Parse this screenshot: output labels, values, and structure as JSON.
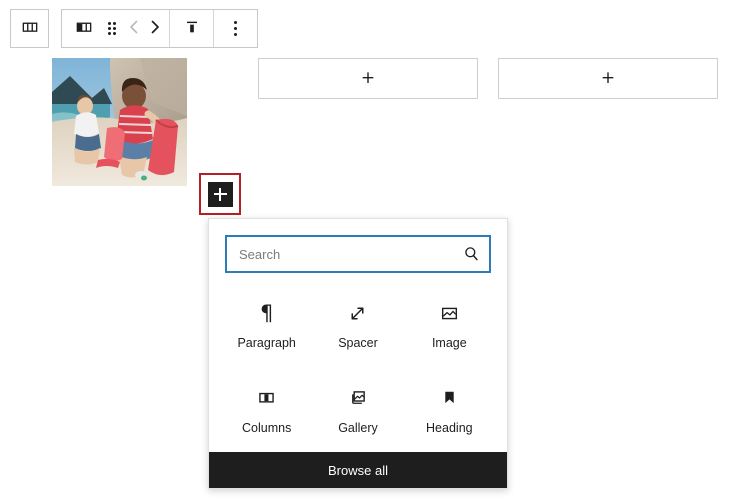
{
  "toolbar": {
    "block_type_button": {
      "icon": "columns-icon",
      "label": "Columns"
    },
    "items": [
      {
        "icon": "column-layout-icon",
        "label": "Change column layout"
      },
      {
        "icon": "drag-handle-icon",
        "label": "Drag"
      },
      {
        "icon": "chevron-left-icon",
        "label": "Move left"
      },
      {
        "icon": "chevron-right-icon",
        "label": "Move right"
      },
      {
        "icon": "align-top-icon",
        "label": "Change vertical alignment"
      },
      {
        "icon": "more-options-icon",
        "label": "Options"
      }
    ]
  },
  "content": {
    "image_block": {
      "icon": "beach-cleanup-photo",
      "alt": "Two people collecting litter in red bags on a sandy beach"
    },
    "placeholders": [
      {
        "icon": "plus-icon",
        "label": "+"
      },
      {
        "icon": "plus-icon",
        "label": "+"
      }
    ]
  },
  "inserter": {
    "button": {
      "icon": "plus-icon",
      "label": "Add block",
      "highlight_color": "#b32126"
    },
    "popover": {
      "search": {
        "placeholder": "Search",
        "value": "",
        "icon": "search-icon",
        "focus_color": "#2b7cb9"
      },
      "blocks": [
        {
          "label": "Paragraph",
          "icon": "paragraph-icon"
        },
        {
          "label": "Spacer",
          "icon": "spacer-icon"
        },
        {
          "label": "Image",
          "icon": "image-icon"
        },
        {
          "label": "Columns",
          "icon": "columns-icon"
        },
        {
          "label": "Gallery",
          "icon": "gallery-icon"
        },
        {
          "label": "Heading",
          "icon": "heading-icon"
        }
      ],
      "browse_all_label": "Browse all"
    }
  }
}
